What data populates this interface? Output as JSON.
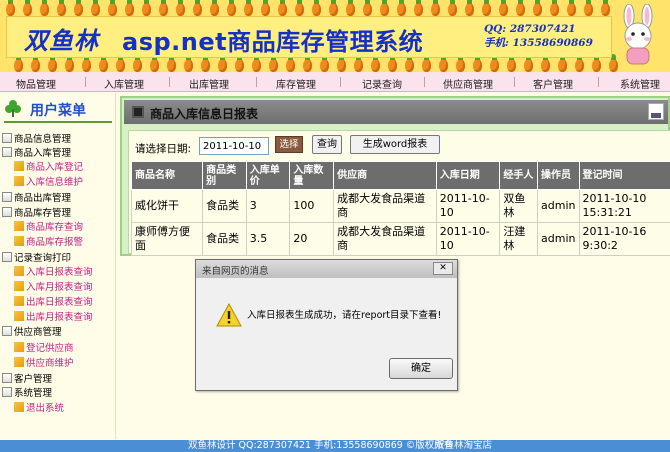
{
  "banner": {
    "brand": "双鱼林",
    "title": "asp.net商品库存管理系统",
    "qq": "QQ: 287307421",
    "phone": "手机: 13558690869"
  },
  "nav": {
    "items": [
      "物品管理",
      "入库管理",
      "出库管理",
      "库存管理",
      "记录查询",
      "供应商管理",
      "客户管理",
      "系统管理"
    ]
  },
  "sidebar": {
    "title": "用户菜单",
    "items": [
      {
        "label": "商品信息管理",
        "level": 1
      },
      {
        "label": "商品入库管理",
        "level": 1
      },
      {
        "label": "商品入库登记",
        "level": 2
      },
      {
        "label": "入库信息维护",
        "level": 2
      },
      {
        "label": "商品出库管理",
        "level": 1
      },
      {
        "label": "商品库存管理",
        "level": 1
      },
      {
        "label": "商品库存查询",
        "level": 2
      },
      {
        "label": "商品库存报警",
        "level": 2
      },
      {
        "label": "记录查询打印",
        "level": 1
      },
      {
        "label": "入库日报表查询",
        "level": 2
      },
      {
        "label": "入库月报表查询",
        "level": 2
      },
      {
        "label": "出库日报表查询",
        "level": 2
      },
      {
        "label": "出库月报表查询",
        "level": 2
      },
      {
        "label": "供应商管理",
        "level": 1
      },
      {
        "label": "登记供应商",
        "level": 2
      },
      {
        "label": "供应商维护",
        "level": 2
      },
      {
        "label": "客户管理",
        "level": 1
      },
      {
        "label": "系统管理",
        "level": 1
      },
      {
        "label": "退出系统",
        "level": 2
      }
    ]
  },
  "panel": {
    "title": "商品入库信息日报表",
    "date_label": "请选择日期:",
    "date_value": "2011-10-10",
    "pick_label": "选择",
    "query_label": "查询",
    "word_label": "生成word报表"
  },
  "table": {
    "headers": [
      "商品名称",
      "商品类别",
      "入库单价",
      "入库数量",
      "供应商",
      "入库日期",
      "经手人",
      "操作员",
      "登记时间"
    ],
    "rows": [
      [
        "威化饼干",
        "食品类",
        "3",
        "100",
        "成都大发食品渠道商",
        "2011-10-10",
        "双鱼林",
        "admin",
        "2011-10-10 15:31:21"
      ],
      [
        "康师傅方便面",
        "食品类",
        "3.5",
        "20",
        "成都大发食品渠道商",
        "2011-10-10",
        "汪建林",
        "admin",
        "2011-10-16 9:30:2"
      ]
    ]
  },
  "dialog": {
    "title": "来自网页的消息",
    "message": "入库日报表生成成功，请在report目录下查看!",
    "ok": "确定"
  },
  "footer": {
    "text": "双鱼林设计 QQ:287307421 手机:13558690869 ©版权所有",
    "link": "双鱼林淘宝店"
  }
}
